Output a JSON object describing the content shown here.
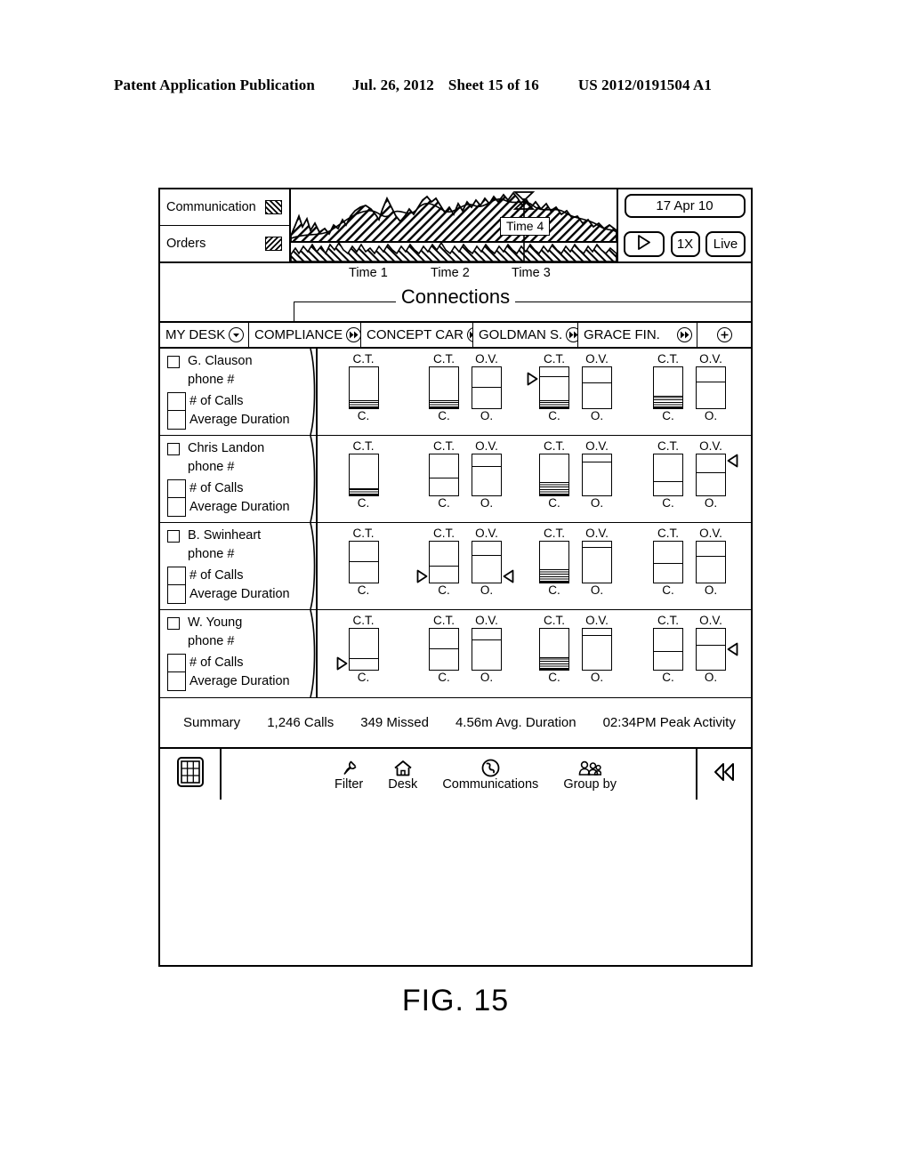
{
  "page_header": {
    "title": "Patent Application Publication",
    "date": "Jul. 26, 2012",
    "sheet": "Sheet 15 of 16",
    "pub_number": "US 2012/0191504 A1"
  },
  "figure_caption": "FIG. 15",
  "chart_legend": [
    {
      "label": "Communication",
      "pattern": "hatch-a"
    },
    {
      "label": "Orders",
      "pattern": "hatch-b"
    }
  ],
  "timeline": {
    "marker_label": "Time 4",
    "ticks": [
      "Time 1",
      "Time 2",
      "Time 3"
    ]
  },
  "controls": {
    "date": "17 Apr 10",
    "play": "play-icon",
    "rate": "1X",
    "live": "Live"
  },
  "section_title": "Connections",
  "columns": [
    {
      "label": "MY DESK",
      "icon": "chevron-down-icon"
    },
    {
      "label": "COMPLIANCE",
      "icon": "fast-forward-icon"
    },
    {
      "label": "CONCEPT CAR",
      "icon": "fast-forward-icon"
    },
    {
      "label": "GOLDMAN S.",
      "icon": "fast-forward-icon"
    },
    {
      "label": "GRACE FIN.",
      "icon": "fast-forward-icon"
    },
    {
      "label": "",
      "icon": "add-icon"
    }
  ],
  "metric_labels": {
    "phone": "phone #",
    "calls": "# of Calls",
    "duration": "Average Duration"
  },
  "bar_captions": {
    "ct": "C.T.",
    "ov": "O.V.",
    "c": "C.",
    "o": "O."
  },
  "rows": [
    {
      "name": "G. Clauson",
      "groups": [
        {
          "bars": [
            {
              "cap": "C.T.",
              "foot": "C.",
              "divider": null,
              "hatch": 0.84
            }
          ]
        },
        {
          "bars": [
            {
              "cap": "C.T.",
              "foot": "C.",
              "divider": null,
              "hatch": 0.84
            },
            {
              "cap": "O.V.",
              "foot": "O.",
              "divider": 0.5,
              "hatch": null
            }
          ]
        },
        {
          "bars": [
            {
              "cap": "C.T.",
              "foot": "C.",
              "divider": 0.22,
              "hatch": 0.84,
              "marker": "left-mid-right-tri"
            },
            {
              "cap": "O.V.",
              "foot": "O.",
              "divider": 0.38,
              "hatch": null
            }
          ]
        },
        {
          "bars": [
            {
              "cap": "C.T.",
              "foot": "C.",
              "divider": null,
              "hatch": 0.72
            },
            {
              "cap": "O.V.",
              "foot": "O.",
              "divider": 0.36,
              "hatch": null
            }
          ]
        }
      ]
    },
    {
      "name": "Chris Landon",
      "groups": [
        {
          "bars": [
            {
              "cap": "C.T.",
              "foot": "C.",
              "divider": null,
              "hatch": 0.86
            }
          ]
        },
        {
          "bars": [
            {
              "cap": "C.T.",
              "foot": "C.",
              "divider": 0.6,
              "hatch": null
            },
            {
              "cap": "O.V.",
              "foot": "O.",
              "divider": 0.3,
              "hatch": null
            }
          ]
        },
        {
          "bars": [
            {
              "cap": "C.T.",
              "foot": "C.",
              "divider": null,
              "hatch": 0.7
            },
            {
              "cap": "O.V.",
              "foot": "O.",
              "divider": 0.18,
              "hatch": null
            }
          ]
        },
        {
          "bars": [
            {
              "cap": "C.T.",
              "foot": "C.",
              "divider": 0.68,
              "hatch": null
            },
            {
              "cap": "O.V.",
              "foot": "O.",
              "divider": 0.46,
              "hatch": null,
              "marker": "right-top-left-tri"
            }
          ]
        }
      ]
    },
    {
      "name": "B. Swinheart",
      "groups": [
        {
          "bars": [
            {
              "cap": "C.T.",
              "foot": "C.",
              "divider": 0.5,
              "hatch": null
            }
          ]
        },
        {
          "bars": [
            {
              "cap": "C.T.",
              "foot": "C.",
              "divider": 0.62,
              "hatch": null,
              "marker": "left-bot-right-tri"
            },
            {
              "cap": "O.V.",
              "foot": "O.",
              "divider": 0.34,
              "hatch": null,
              "marker": "right-bot-left-tri"
            }
          ]
        },
        {
          "bars": [
            {
              "cap": "C.T.",
              "foot": "C.",
              "divider": null,
              "hatch": 0.7
            },
            {
              "cap": "O.V.",
              "foot": "O.",
              "divider": 0.14,
              "hatch": null
            }
          ]
        },
        {
          "bars": [
            {
              "cap": "C.T.",
              "foot": "C.",
              "divider": 0.54,
              "hatch": null
            },
            {
              "cap": "O.V.",
              "foot": "O.",
              "divider": 0.36,
              "hatch": null
            }
          ]
        }
      ]
    },
    {
      "name": "W. Young",
      "groups": [
        {
          "bars": [
            {
              "cap": "C.T.",
              "foot": "C.",
              "divider": 0.76,
              "hatch": null,
              "marker": "left-bot-right-tri"
            }
          ]
        },
        {
          "bars": [
            {
              "cap": "C.T.",
              "foot": "C.",
              "divider": 0.5,
              "hatch": null
            },
            {
              "cap": "O.V.",
              "foot": "O.",
              "divider": 0.28,
              "hatch": null
            }
          ]
        },
        {
          "bars": [
            {
              "cap": "C.T.",
              "foot": "C.",
              "divider": null,
              "hatch": 0.72
            },
            {
              "cap": "O.V.",
              "foot": "O.",
              "divider": 0.16,
              "hatch": null
            }
          ]
        },
        {
          "bars": [
            {
              "cap": "C.T.",
              "foot": "C.",
              "divider": 0.56,
              "hatch": null
            },
            {
              "cap": "O.V.",
              "foot": "O.",
              "divider": 0.4,
              "hatch": null,
              "marker": "right-mid-left-tri"
            }
          ]
        }
      ]
    }
  ],
  "summary": {
    "label": "Summary",
    "items": [
      "1,246 Calls",
      "349 Missed",
      "4.56m Avg. Duration",
      "02:34PM Peak Activity"
    ]
  },
  "footer": {
    "grid_button": "grid-icon",
    "items": [
      {
        "label": "Filter",
        "icon": "filter-pin-icon"
      },
      {
        "label": "Desk",
        "icon": "home-icon"
      },
      {
        "label": "Communications",
        "icon": "phone-icon"
      },
      {
        "label": "Group by",
        "icon": "people-icon"
      }
    ],
    "rewind": "rewind-icon"
  }
}
